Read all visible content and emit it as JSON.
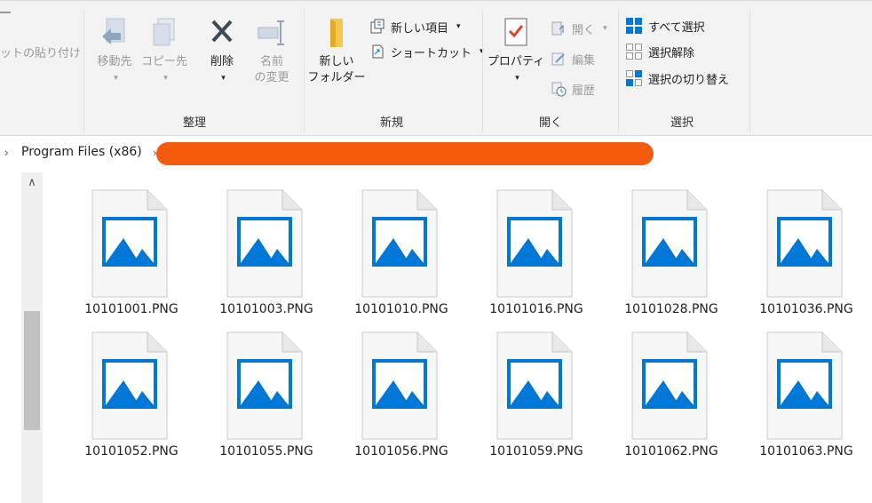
{
  "ribbon": {
    "clipboard": {
      "paste_shortcut_label": "ットの貼り付け"
    },
    "organize": {
      "group_label": "整理",
      "move_to": "移動先",
      "copy_to": "コピー先",
      "delete": "削除",
      "rename_line1": "名前",
      "rename_line2": "の変更"
    },
    "new": {
      "group_label": "新規",
      "new_folder_line1": "新しい",
      "new_folder_line2": "フォルダー",
      "new_item": "新しい項目",
      "shortcut": "ショートカット"
    },
    "open": {
      "group_label": "開く",
      "properties": "プロパティ",
      "open": "開く",
      "edit": "編集",
      "history": "履歴"
    },
    "select": {
      "group_label": "選択",
      "select_all": "すべて選択",
      "select_none": "選択解除",
      "invert_selection": "選択の切り替え"
    }
  },
  "address": {
    "crumb": "Program Files (x86)"
  },
  "files": [
    {
      "name": "10101001.PNG"
    },
    {
      "name": "10101003.PNG"
    },
    {
      "name": "10101010.PNG"
    },
    {
      "name": "10101016.PNG"
    },
    {
      "name": "10101028.PNG"
    },
    {
      "name": "10101036.PNG"
    },
    {
      "name": "10101052.PNG"
    },
    {
      "name": "10101055.PNG"
    },
    {
      "name": "10101056.PNG"
    },
    {
      "name": "10101059.PNG"
    },
    {
      "name": "10101062.PNG"
    },
    {
      "name": "10101063.PNG"
    }
  ],
  "icons": {
    "image_file": "image-file-icon",
    "accent": "#0078d7",
    "redaction": "#f45b0c"
  }
}
